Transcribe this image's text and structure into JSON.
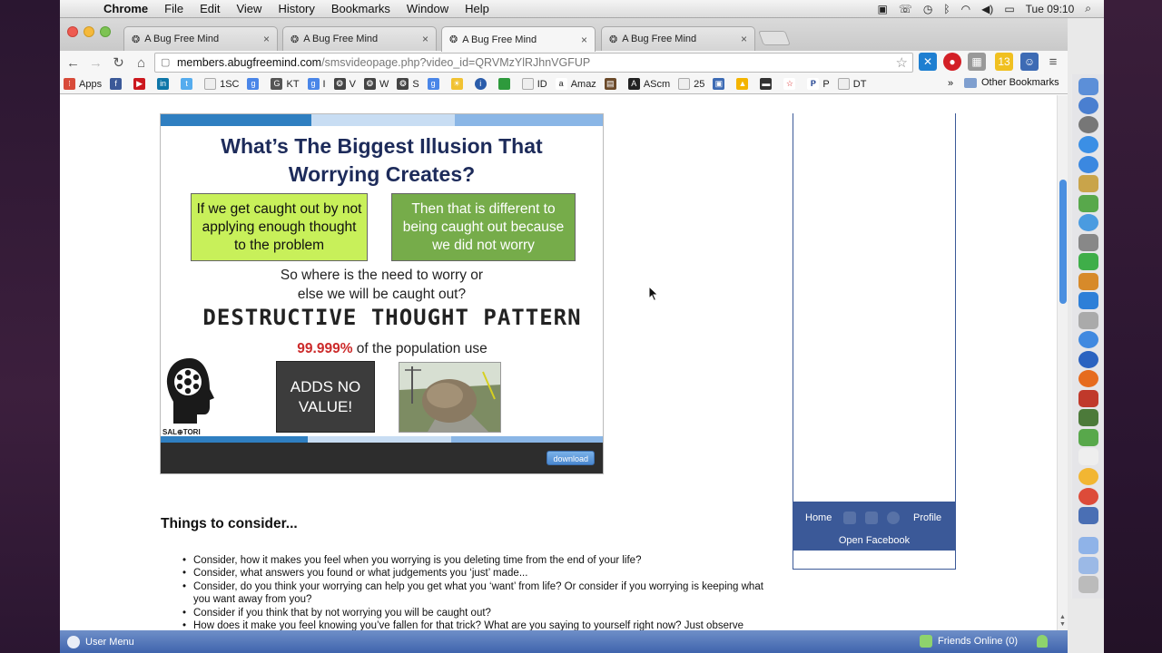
{
  "menubar": {
    "app": "Chrome",
    "items": [
      "File",
      "Edit",
      "View",
      "History",
      "Bookmarks",
      "Window",
      "Help"
    ],
    "clock": "Tue 09:10"
  },
  "tabs": [
    {
      "title": "A Bug Free Mind",
      "active": false
    },
    {
      "title": "A Bug Free Mind",
      "active": false
    },
    {
      "title": "A Bug Free Mind",
      "active": true
    },
    {
      "title": "A Bug Free Mind",
      "active": false
    }
  ],
  "url": {
    "host": "members.abugfreemind.com",
    "path": "/smsvideopage.php?video_id=QRVMzYlRJhnVGFUP"
  },
  "bookmarks": {
    "items": [
      "Apps",
      "",
      "",
      "",
      "",
      "1SC",
      "",
      "KT",
      "I",
      "V",
      "W",
      "S",
      "",
      "",
      "",
      "",
      "ID",
      "Amaz",
      "",
      "AScm",
      "25",
      "",
      "",
      "",
      "",
      "P",
      "DT"
    ],
    "more": "»",
    "other": "Other Bookmarks"
  },
  "slide": {
    "title_line1": "What’s The Biggest Illusion That",
    "title_line2": "Worrying Creates?",
    "box_left": "If we get caught out by not applying enough thought to the problem",
    "box_right": "Then that is different to being caught out because we did not worry",
    "question_line1": "So where is the need to worry or",
    "question_line2": "else we will be caught out?",
    "pattern": "DESTRUCTIVE THOUGHT PATTERN",
    "percent": "99.999%",
    "percent_rest": " of the population use",
    "adds_no_value": "ADDS NO VALUE!",
    "logo_text": "SAL⊕TORI",
    "download_label": "download"
  },
  "things": {
    "title": "Things to consider...",
    "items": [
      "Consider, how it makes you feel when you worrying is you deleting time from the end of your life?",
      "Consider, what answers you found or what judgements you ‘just’ made...",
      "Consider, do you think your worrying can help you get what you ‘want’ from life? Or consider if you worrying is keeping what you want away from you?",
      "Consider if you think that by not worrying you will be caught out?",
      "How does it make you feel knowing you’ve fallen for that trick? What are you saying to yourself right now? Just observe remember, don’t judge."
    ]
  },
  "facebook": {
    "home": "Home",
    "profile": "Profile",
    "open": "Open Facebook"
  },
  "chatbar": {
    "user_menu": "User Menu",
    "friends_online": "Friends Online (0)"
  },
  "colors": {
    "slide_title": "#1d2b5a",
    "box_left": "#c8f05a",
    "box_right": "#76ac4a",
    "facebook_blue": "#3b5998",
    "percent_red": "#cc2a2a"
  }
}
